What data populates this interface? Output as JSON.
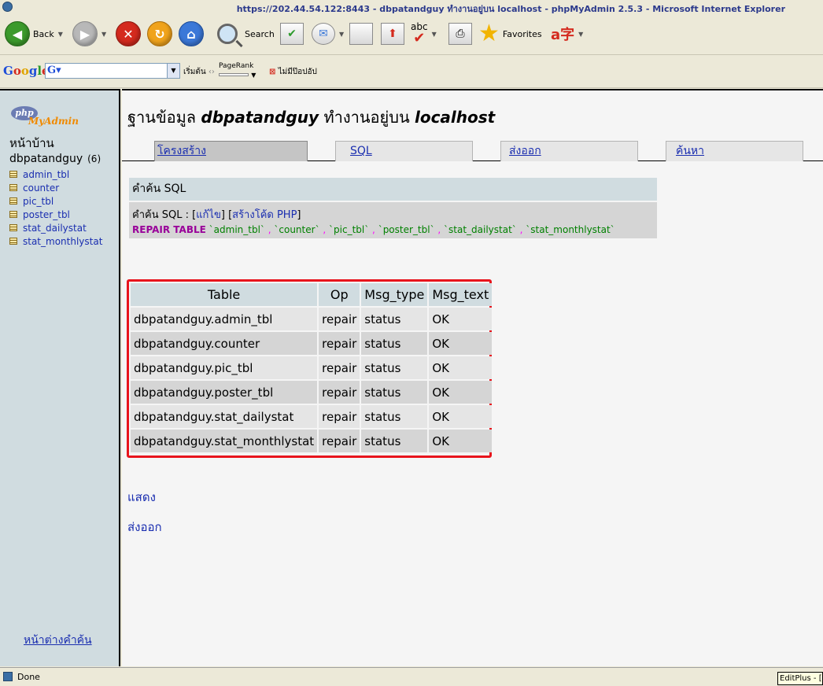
{
  "window": {
    "title": "https://202.44.54.122:8443 - dbpatandguy ทำงานอยู่บน localhost - phpMyAdmin 2.5.3 - Microsoft Internet Explorer"
  },
  "toolbar": {
    "back_label": "Back",
    "search_label": "Search",
    "favorites_label": "Favorites"
  },
  "google_bar": {
    "logo": "Google",
    "search_value": "",
    "start_label": "เริ่มต้น",
    "pagerank_label": "PageRank",
    "popup_label": "ไม่มีป๊อปอัป"
  },
  "sidebar": {
    "logo_php": "php",
    "logo_myadmin": "MyAdmin",
    "home_label": "หน้าบ้าน",
    "db_name": "dbpatandguy",
    "db_count": "(6)",
    "tables": [
      "admin_tbl",
      "counter",
      "pic_tbl",
      "poster_tbl",
      "stat_dailystat",
      "stat_monthlystat"
    ],
    "query_window_label": "หน้าต่างคำค้น"
  },
  "main": {
    "title_prefix": "ฐานข้อมูล",
    "title_db": "dbpatandguy",
    "title_middle": "ทำงานอยู่บน",
    "title_host": "localhost",
    "tabs": [
      {
        "label": "โครงสร้าง"
      },
      {
        "label": "SQL"
      },
      {
        "label": "ส่งออก"
      },
      {
        "label": "ค้นหา"
      }
    ],
    "sql_heading": "คำค้น SQL",
    "sql_query_label": "คำค้น SQL :",
    "edit_link": "แก้ไข",
    "create_php_link": "สร้างโค้ด PHP",
    "sql_keyword": "REPAIR TABLE",
    "sql_tables": [
      "`admin_tbl`",
      "`counter`",
      "`pic_tbl`",
      "`poster_tbl`",
      "`stat_dailystat`",
      "`stat_monthlystat`"
    ],
    "results": {
      "columns": [
        "Table",
        "Op",
        "Msg_type",
        "Msg_text"
      ],
      "rows": [
        [
          "dbpatandguy.admin_tbl",
          "repair",
          "status",
          "OK"
        ],
        [
          "dbpatandguy.counter",
          "repair",
          "status",
          "OK"
        ],
        [
          "dbpatandguy.pic_tbl",
          "repair",
          "status",
          "OK"
        ],
        [
          "dbpatandguy.poster_tbl",
          "repair",
          "status",
          "OK"
        ],
        [
          "dbpatandguy.stat_dailystat",
          "repair",
          "status",
          "OK"
        ],
        [
          "dbpatandguy.stat_monthlystat",
          "repair",
          "status",
          "OK"
        ]
      ]
    },
    "show_link": "แสดง",
    "export_link": "ส่งออก"
  },
  "status_bar": {
    "text": "Done",
    "tooltip": "EditPlus - [C"
  },
  "colors": {
    "highlight_border": "#e8141c",
    "link": "#1a2eb0",
    "sidebar_bg": "#d0dce0"
  }
}
